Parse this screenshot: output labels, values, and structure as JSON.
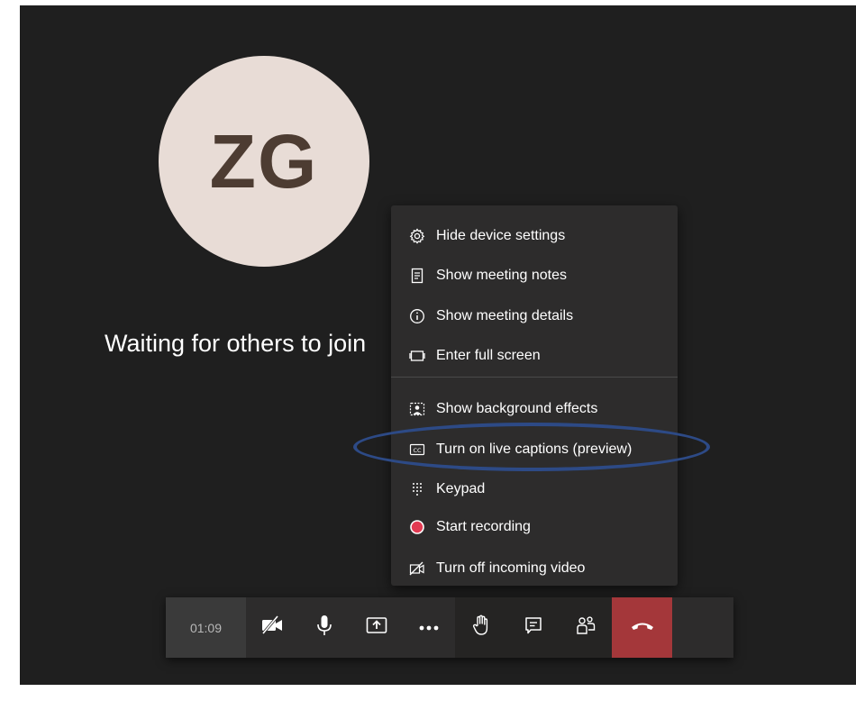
{
  "participant": {
    "initials": "ZG"
  },
  "status": {
    "waiting_text": "Waiting for others to join"
  },
  "menu": {
    "items": [
      {
        "label": "Hide device settings",
        "icon": "gear-icon"
      },
      {
        "label": "Show meeting notes",
        "icon": "notes-icon"
      },
      {
        "label": "Show meeting details",
        "icon": "info-icon"
      },
      {
        "label": "Enter full screen",
        "icon": "fullscreen-icon"
      },
      {
        "label": "Show background effects",
        "icon": "background-effects-icon"
      },
      {
        "label": "Turn on live captions (preview)",
        "icon": "closed-captions-icon"
      },
      {
        "label": "Keypad",
        "icon": "keypad-icon"
      },
      {
        "label": "Start recording",
        "icon": "record-icon"
      },
      {
        "label": "Turn off incoming video",
        "icon": "video-off-icon"
      }
    ]
  },
  "toolbar": {
    "timer": "01:09",
    "buttons": [
      {
        "name": "camera-toggle",
        "icon": "video-off-icon"
      },
      {
        "name": "microphone",
        "icon": "microphone-icon"
      },
      {
        "name": "share-screen",
        "icon": "share-icon"
      },
      {
        "name": "more-actions",
        "icon": "ellipsis-icon"
      },
      {
        "name": "raise-hand",
        "icon": "hand-icon"
      },
      {
        "name": "chat",
        "icon": "chat-icon"
      },
      {
        "name": "participants",
        "icon": "people-icon"
      },
      {
        "name": "hang-up",
        "icon": "phone-hangup-icon"
      }
    ]
  },
  "colors": {
    "stage_bg": "#1f1f1f",
    "avatar_bg": "#e8dcd6",
    "avatar_text": "#4d3c32",
    "menu_bg": "#2d2c2c",
    "hangup_red": "#a4373a",
    "record_red": "#e23a52",
    "highlight_ring": "#2d4a86"
  }
}
